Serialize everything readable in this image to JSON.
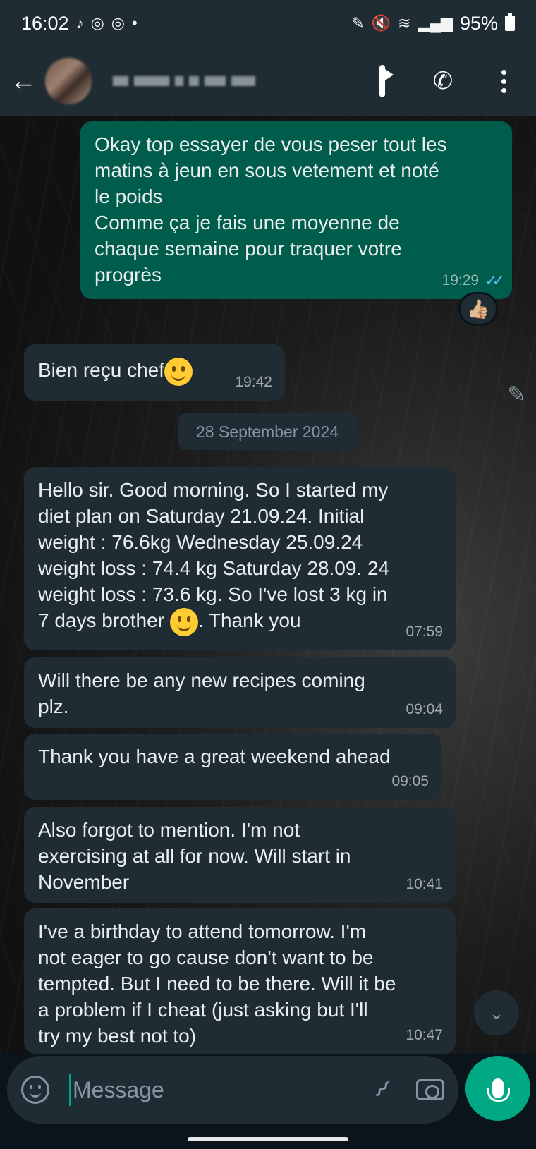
{
  "status_bar": {
    "time": "16:02",
    "battery": "95%",
    "left_icons": [
      "tiktok-icon",
      "instagram-icon",
      "instagram-icon",
      "dot-icon"
    ],
    "right_icons": [
      "nfc-icon",
      "mute-icon",
      "wifi-icon",
      "signal-icon",
      "battery-icon"
    ]
  },
  "header": {
    "contact_name": "",
    "actions": [
      "video-call-icon",
      "voice-call-icon",
      "more-options-icon"
    ]
  },
  "messages": [
    {
      "direction": "out",
      "text": "Okay top essayer de vous peser tout les\nmatins à jeun en sous vetement  et noté\nle poids\nComme ça je fais une moyenne de\nchaque semaine pour  traquer votre\nprogrès",
      "time": "19:29",
      "reaction": "👍🏼"
    },
    {
      "direction": "in",
      "text": "Bien reçu chef",
      "time": "19:42"
    },
    {
      "direction": "in",
      "text_a": "Hello sir. Good morning. So I started my\ndiet plan on Saturday 21.09.24. Initial\nweight : 76.6kg Wednesday 25.09.24\nweight loss : 74.4 kg Saturday 28.09. 24\nweight loss : 73.6 kg. So I've lost 3 kg in\n7 days brother ",
      "text_b": ". Thank you",
      "time": "07:59"
    },
    {
      "direction": "in",
      "text": "Will there be any new recipes coming\nplz.",
      "time": "09:04"
    },
    {
      "direction": "in",
      "text": "Thank you have a great weekend ahead",
      "time": "09:05"
    },
    {
      "direction": "in",
      "text": "Also forgot to mention. I'm not\nexercising at all for now. Will start in\nNovember",
      "time": "10:41"
    },
    {
      "direction": "in",
      "text": "I've a birthday to attend tomorrow. I'm\nnot eager to go cause don't want to be\ntempted. But I need to be there. Will it be\na problem if I cheat (just asking but I'll\ntry my best not to)",
      "time": "10:47"
    }
  ],
  "date_separator": "28 September 2024",
  "composer": {
    "placeholder": "Message"
  },
  "colors": {
    "outgoing_bubble": "#005c4b",
    "incoming_bubble": "#1f2c34",
    "accent": "#00a884",
    "read_ticks": "#53bdeb"
  }
}
